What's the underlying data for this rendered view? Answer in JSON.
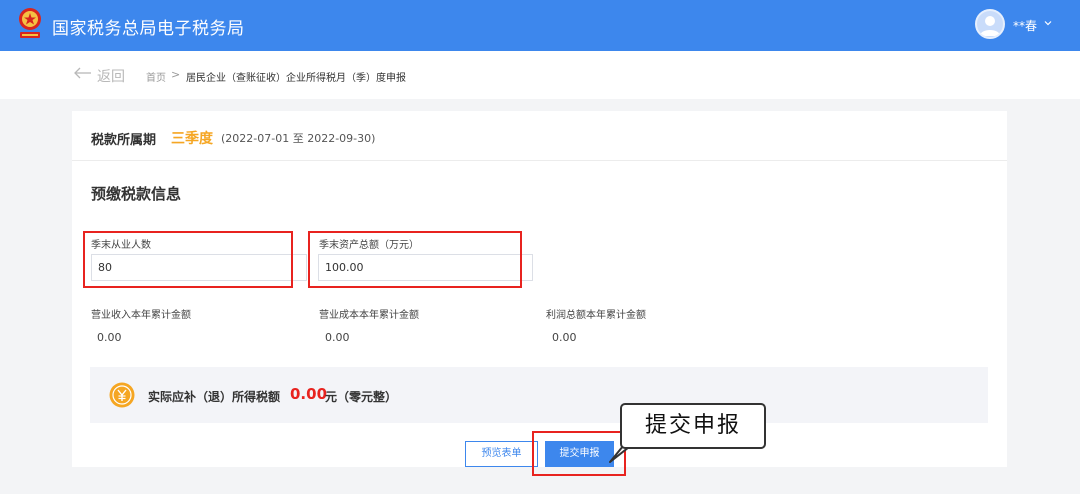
{
  "header": {
    "title": "国家税务总局电子税务局",
    "user_name": "**春"
  },
  "breadcrumb": {
    "back_label": "返回",
    "home": "首页",
    "separator": ">",
    "current": "居民企业（查账征收）企业所得税月（季）度申报"
  },
  "period": {
    "label": "税款所属期",
    "name": "三季度",
    "range": "(2022-07-01 至 2022-09-30)"
  },
  "section": {
    "title": "预缴税款信息"
  },
  "fields": {
    "employees": {
      "label": "季末从业人数",
      "value": "80"
    },
    "assets": {
      "label": "季末资产总额（万元）",
      "value": "100.00"
    },
    "revenue": {
      "label": "营业收入本年累计金额",
      "value": "0.00"
    },
    "cost": {
      "label": "营业成本本年累计金额",
      "value": "0.00"
    },
    "profit": {
      "label": "利润总额本年累计金额",
      "value": "0.00"
    }
  },
  "tax": {
    "label": "实际应补（退）所得税额",
    "amount": "0.00",
    "unit": "元（零元整）"
  },
  "buttons": {
    "preview": "预览表单",
    "submit": "提交申报"
  },
  "callout": {
    "text": "提交申报"
  },
  "colors": {
    "brand": "#3d87ed",
    "period_accent": "#f5a623",
    "highlight": "#e8231f"
  }
}
